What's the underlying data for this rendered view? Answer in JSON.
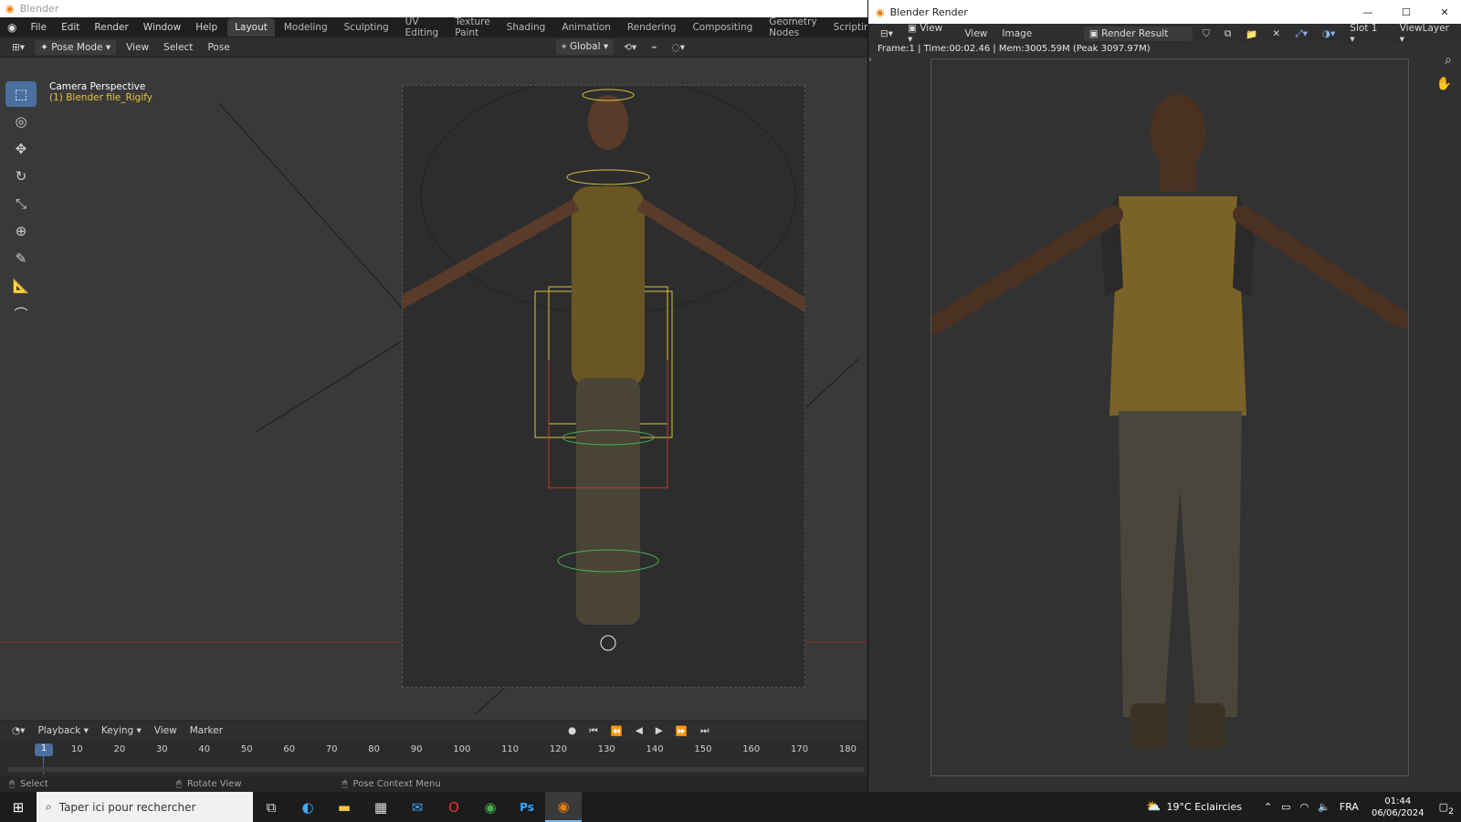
{
  "blender": {
    "window_title": "Blender",
    "menus": [
      "File",
      "Edit",
      "Render",
      "Window",
      "Help"
    ],
    "workspaces": [
      "Layout",
      "Modeling",
      "Sculpting",
      "UV Editing",
      "Texture Paint",
      "Shading",
      "Animation",
      "Rendering",
      "Compositing",
      "Geometry Nodes",
      "Scripting"
    ],
    "active_workspace": "Layout",
    "mode": "Pose Mode",
    "header_menus": [
      "View",
      "Select",
      "Pose"
    ],
    "transform_orientation": "Global",
    "viewport": {
      "title": "Camera Perspective",
      "object": "(1) Blender file_Rigify"
    },
    "toolbar_icons": [
      "select-box-icon",
      "cursor-icon",
      "move-icon",
      "rotate-icon",
      "scale-icon",
      "transform-icon",
      "annotate-icon",
      "measure-icon",
      "pose-relax-icon"
    ]
  },
  "timeline": {
    "menus": [
      "Playback",
      "Keying",
      "View",
      "Marker"
    ],
    "current_frame": "1",
    "ticks": [
      "10",
      "20",
      "30",
      "40",
      "50",
      "60",
      "70",
      "80",
      "90",
      "100",
      "110",
      "120",
      "130",
      "140",
      "150",
      "160",
      "170",
      "180"
    ]
  },
  "statusbar": {
    "select": "Select",
    "rotate": "Rotate View",
    "context": "Pose Context Menu"
  },
  "render_window": {
    "title": "Blender Render",
    "menus": [
      "View",
      "View",
      "Image"
    ],
    "result": "Render Result",
    "slot": "Slot 1",
    "view_layer": "ViewLayer",
    "info": "Frame:1 | Time:00:02.46 | Mem:3005.59M (Peak 3097.97M)"
  },
  "taskbar": {
    "search_placeholder": "Taper ici pour rechercher",
    "weather": "19°C  Eclaircies",
    "lang": "FRA",
    "time": "01:44",
    "date": "06/06/2024",
    "notifications": "2"
  }
}
